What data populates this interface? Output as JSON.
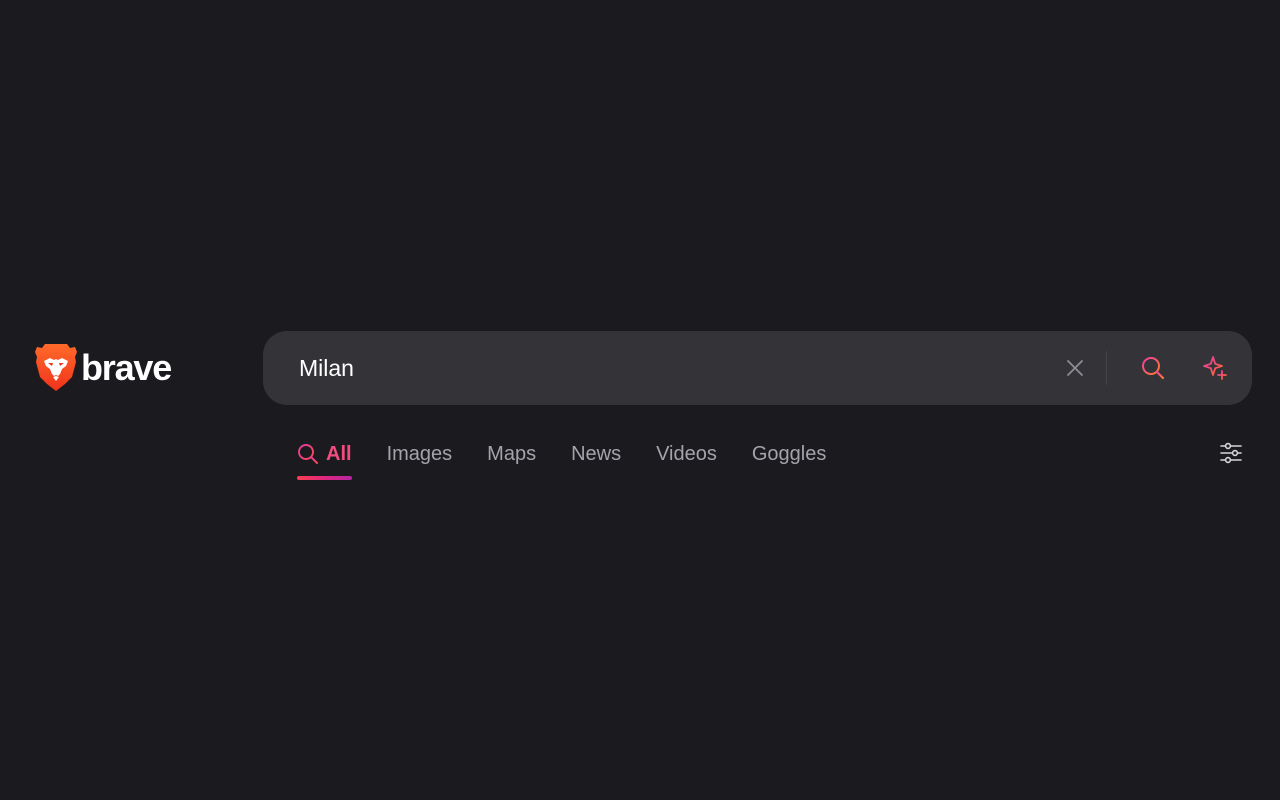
{
  "brand": {
    "name": "brave"
  },
  "search": {
    "query": "Milan",
    "placeholder": ""
  },
  "tabs": [
    {
      "label": "All",
      "active": true
    },
    {
      "label": "Images",
      "active": false
    },
    {
      "label": "Maps",
      "active": false
    },
    {
      "label": "News",
      "active": false
    },
    {
      "label": "Videos",
      "active": false
    },
    {
      "label": "Goggles",
      "active": false
    }
  ],
  "icons": {
    "logo": "brave-lion-icon",
    "clear": "close-icon",
    "search": "search-icon",
    "ai": "sparkle-icon",
    "settings": "sliders-icon"
  },
  "colors": {
    "background": "#1b1a1f",
    "search_bar": "#343338",
    "active_tab": "#f24d7e",
    "inactive_tab": "#a4a3aa",
    "brand_orange": "#fb542b"
  }
}
